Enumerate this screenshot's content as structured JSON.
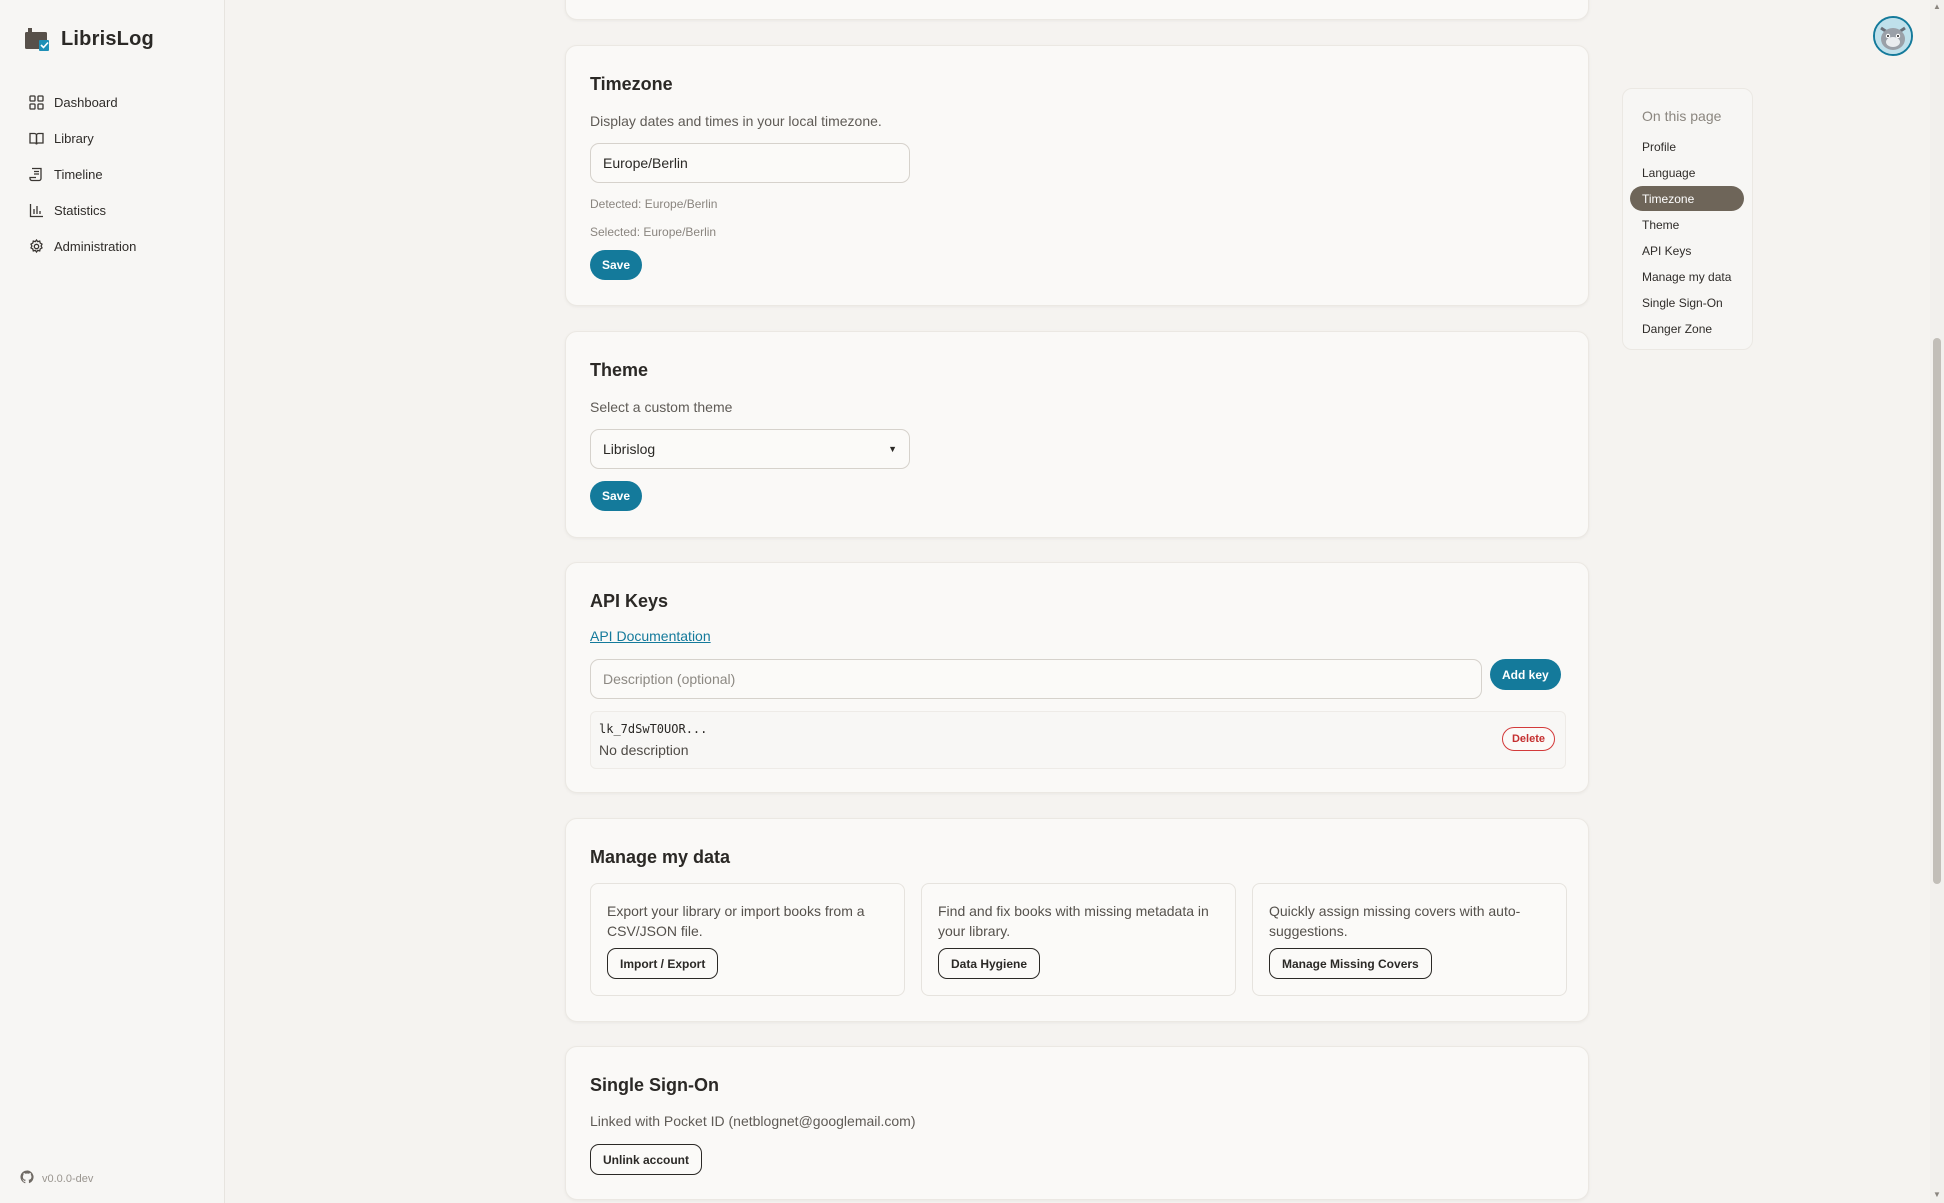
{
  "app": {
    "name": "LibrisLog",
    "version": "v0.0.0-dev"
  },
  "sidebar": {
    "items": [
      {
        "label": "Dashboard",
        "icon": "dashboard-icon"
      },
      {
        "label": "Library",
        "icon": "book-icon"
      },
      {
        "label": "Timeline",
        "icon": "timeline-icon"
      },
      {
        "label": "Statistics",
        "icon": "bar-chart-icon"
      },
      {
        "label": "Administration",
        "icon": "gear-icon"
      }
    ]
  },
  "timezone": {
    "title": "Timezone",
    "description": "Display dates and times in your local timezone.",
    "value": "Europe/Berlin",
    "detected": "Detected: Europe/Berlin",
    "selected": "Selected: Europe/Berlin",
    "save_label": "Save"
  },
  "theme": {
    "title": "Theme",
    "description": "Select a custom theme",
    "selected": "Librislog",
    "save_label": "Save"
  },
  "api_keys": {
    "title": "API Keys",
    "doc_link": "API Documentation",
    "description_placeholder": "Description (optional)",
    "add_label": "Add key",
    "keys": [
      {
        "code": "lk_7dSwT0UOR...",
        "description": "No description",
        "delete_label": "Delete"
      }
    ]
  },
  "manage_data": {
    "title": "Manage my data",
    "tiles": [
      {
        "text": "Export your library or import books from a CSV/JSON file.",
        "button": "Import / Export"
      },
      {
        "text": "Find and fix books with missing metadata in your library.",
        "button": "Data Hygiene"
      },
      {
        "text": "Quickly assign missing covers with auto-suggestions.",
        "button": "Manage Missing Covers"
      }
    ]
  },
  "sso": {
    "title": "Single Sign-On",
    "linked_text": "Linked with Pocket ID (netblognet@googlemail.com)",
    "unlink_label": "Unlink account"
  },
  "toc": {
    "title": "On this page",
    "active": "Timezone",
    "items": [
      "Profile",
      "Language",
      "Timezone",
      "Theme",
      "API Keys",
      "Manage my data",
      "Single Sign-On",
      "Danger Zone"
    ]
  },
  "colors": {
    "accent": "#147a9b",
    "active_toc": "#6e6559",
    "danger": "#c53030",
    "background": "#f5f3f0"
  }
}
